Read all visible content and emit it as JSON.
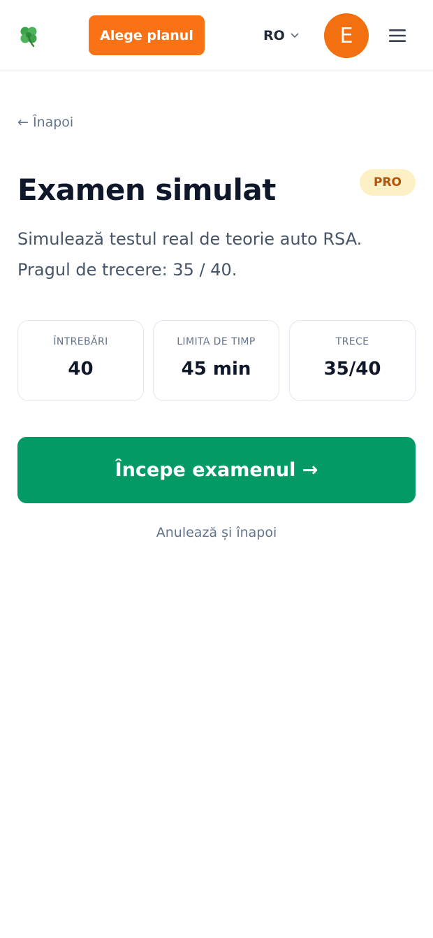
{
  "header": {
    "logo_icon": "four-leaf-clover-icon",
    "plan_button_label": "Alege planul",
    "language": "RO",
    "avatar_initial": "E",
    "menu_icon": "hamburger-menu-icon"
  },
  "page": {
    "back_link": "← Înapoi",
    "title": "Examen simulat",
    "badge": "PRO",
    "description_line1": "Simulează testul real de teorie auto RSA.",
    "description_line2": "Pragul de trecere: 35 / 40."
  },
  "stats": [
    {
      "label": "ÎNTREBĂRI",
      "value": "40"
    },
    {
      "label": "LIMITA DE TIMP",
      "value": "45 min"
    },
    {
      "label": "TRECE",
      "value": "35/40"
    }
  ],
  "actions": {
    "start_label": "Începe examenul →",
    "cancel_label": "Anulează și înapoi"
  },
  "colors": {
    "brand_orange": "#f97316",
    "primary_green": "#039a65",
    "pro_badge_bg": "#fdf0c4",
    "pro_badge_text": "#b45309"
  }
}
